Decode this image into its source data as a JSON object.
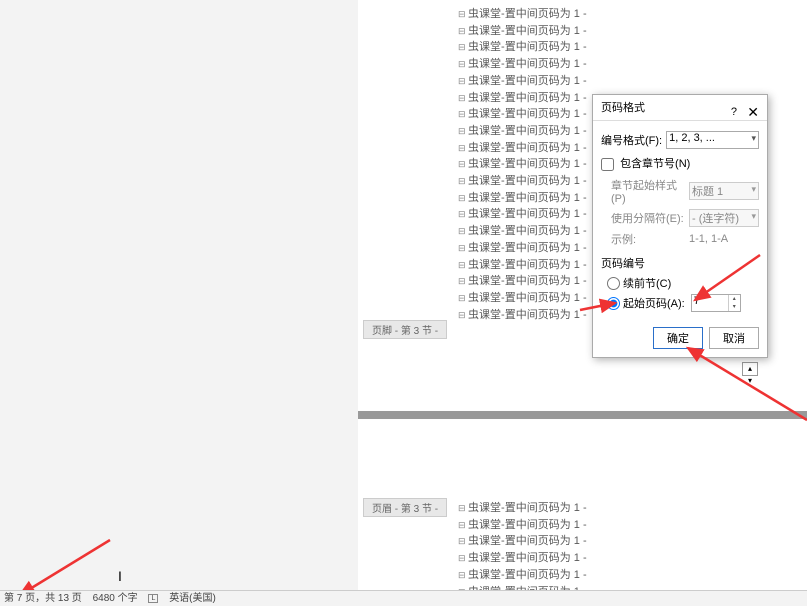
{
  "doc_line": "虫课堂-置中间页码为 1 -",
  "footer_label": "页脚 - 第 3 节 -",
  "header_label": "页眉 - 第 3 节 -",
  "dialog": {
    "title": "页码格式",
    "help": "?",
    "close": "✕",
    "number_format_label": "编号格式(F):",
    "number_format_value": "1, 2, 3, ...",
    "include_chapter": "包含章节号(N)",
    "chapter_start_label": "章节起始样式(P)",
    "chapter_start_value": "标题 1",
    "separator_label": "使用分隔符(E):",
    "separator_value": "- (连字符)",
    "example_label": "示例:",
    "example_value": "1-1, 1-A",
    "page_numbering": "页码编号",
    "continue_prev": "续前节(C)",
    "start_at": "起始页码(A):",
    "start_value": "7",
    "ok": "确定",
    "cancel": "取消"
  },
  "status": {
    "page": "第 7 页，共 13 页",
    "words": "6480 个字",
    "lang": "英语(美国)"
  }
}
